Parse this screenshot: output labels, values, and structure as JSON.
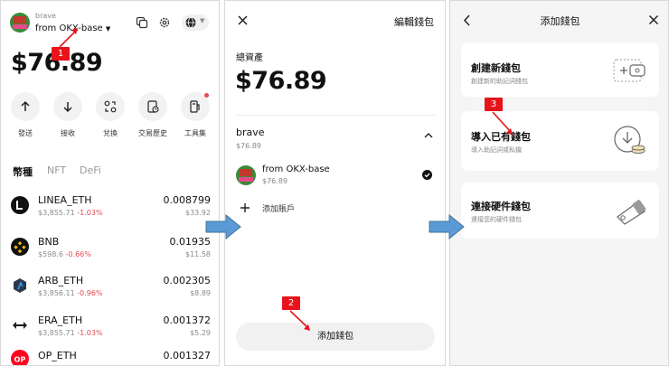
{
  "wallet_panel": {
    "wallet_name": "brave",
    "account_name": "from OKX-base",
    "balance": "$76.89",
    "actions": [
      "發送",
      "接收",
      "兌換",
      "交易歷史",
      "工具集"
    ],
    "tabs": [
      "幣種",
      "NFT",
      "DeFi"
    ],
    "tokens": [
      {
        "name": "LINEA_ETH",
        "price": "$3,855.71",
        "change": "-1.03%",
        "amount": "0.008799",
        "value": "$33.92"
      },
      {
        "name": "BNB",
        "price": "$598.6",
        "change": "-0.66%",
        "amount": "0.01935",
        "value": "$11.58"
      },
      {
        "name": "ARB_ETH",
        "price": "$3,856.11",
        "change": "-0.96%",
        "amount": "0.002305",
        "value": "$8.89"
      },
      {
        "name": "ERA_ETH",
        "price": "$3,855.71",
        "change": "-1.03%",
        "amount": "0.001372",
        "value": "$5.29"
      },
      {
        "name": "OP_ETH",
        "price": "",
        "change": "",
        "amount": "0.001327",
        "value": ""
      }
    ]
  },
  "edit_panel": {
    "edit_link": "編輯錢包",
    "total_label": "總資產",
    "total_value": "$76.89",
    "wallet_name": "brave",
    "wallet_value": "$76.89",
    "account_name": "from OKX-base",
    "account_value": "$76.89",
    "add_account": "添加賬戶",
    "add_wallet_button": "添加錢包"
  },
  "add_panel": {
    "title": "添加錢包",
    "options": [
      {
        "title": "創建新錢包",
        "subtitle": "創建新的助記詞錢包"
      },
      {
        "title": "導入已有錢包",
        "subtitle": "導入助記詞或私鑰"
      },
      {
        "title": "連接硬件錢包",
        "subtitle": "連接您的硬件錢包"
      }
    ]
  },
  "step_labels": [
    "1",
    "2",
    "3"
  ],
  "colors": {
    "step_red": "#e8131b",
    "arrow_blue": "#5b9bd5",
    "negative": "#e5484d"
  },
  "icons": [
    "copy-icon",
    "gear-icon",
    "globe-icon",
    "close-icon",
    "back-icon",
    "chevron-up-icon",
    "check-icon",
    "plus-icon"
  ]
}
